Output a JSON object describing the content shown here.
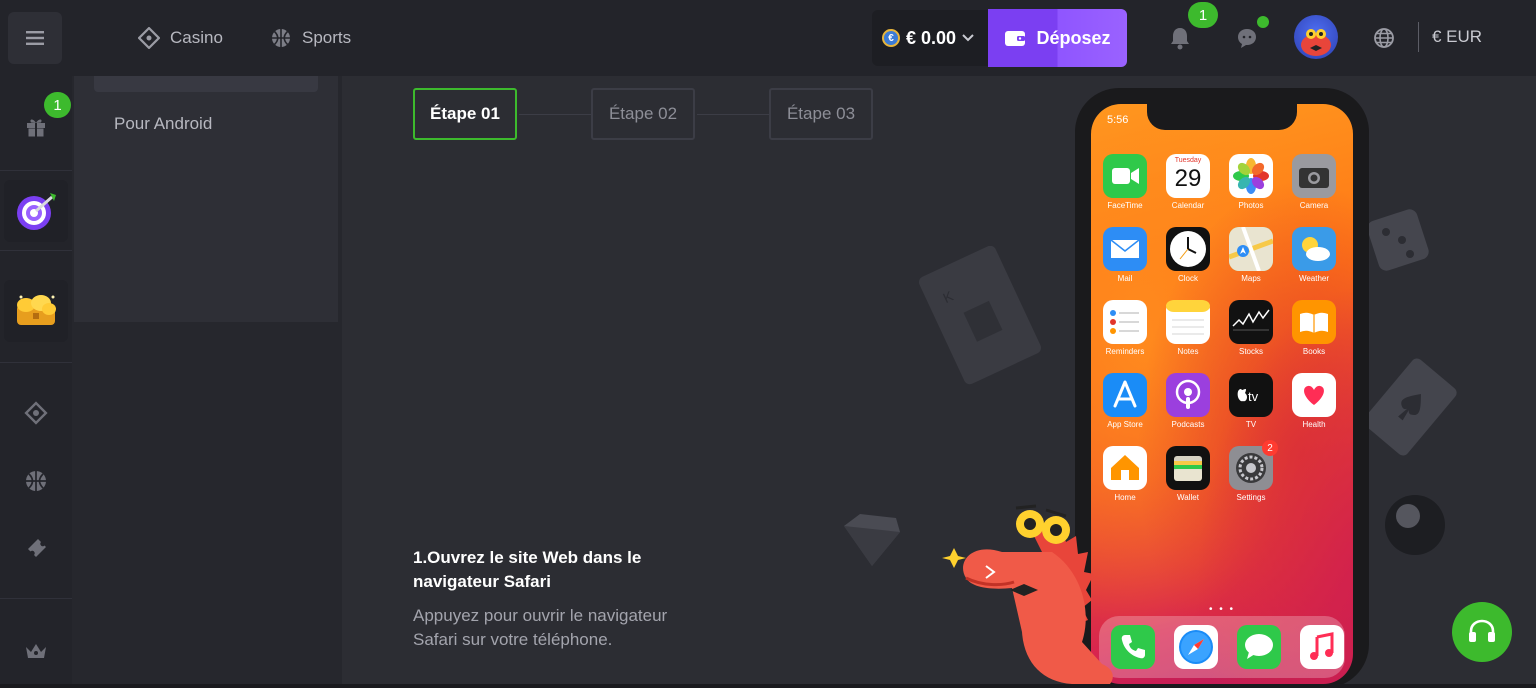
{
  "header": {
    "menu_icon": "hamburger-icon",
    "nav": [
      {
        "label": "Casino",
        "icon": "casino-icon"
      },
      {
        "label": "Sports",
        "icon": "basketball-icon"
      }
    ],
    "balance": "€ 0.00",
    "coin_symbol": "€",
    "deposit_label": "Déposez",
    "notifications_count": "1",
    "currency": "€ EUR"
  },
  "rail": {
    "gift_badge": "1",
    "items": [
      "gift-icon",
      "target-game-icon",
      "treasure-icon",
      "casino-icon",
      "basketball-icon",
      "ticket-icon",
      "crown-icon"
    ]
  },
  "subpanel": {
    "android_link": "Pour Android"
  },
  "steps": [
    "Étape 01",
    "Étape 02",
    "Étape 03"
  ],
  "instruction": {
    "title": "1.Ouvrez le site Web dans le navigateur Safari",
    "text": "Appuyez pour ouvrir le navigateur Safari sur votre téléphone."
  },
  "phone": {
    "time": "5:56",
    "calendar_day": "Tuesday",
    "calendar_date": "29",
    "settings_badge": "2",
    "apps": [
      {
        "label": "FaceTime",
        "color": "#2fc94a"
      },
      {
        "label": "Calendar",
        "color": "#ffffff"
      },
      {
        "label": "Photos",
        "color": "#ffffff"
      },
      {
        "label": "Camera",
        "color": "#9a9a9f"
      },
      {
        "label": "Mail",
        "color": "#2d8df5"
      },
      {
        "label": "Clock",
        "color": "#111111"
      },
      {
        "label": "Maps",
        "color": "#7dd36f"
      },
      {
        "label": "Weather",
        "color": "#3a9be8"
      },
      {
        "label": "Reminders",
        "color": "#ffffff"
      },
      {
        "label": "Notes",
        "color": "#ffd43b"
      },
      {
        "label": "Stocks",
        "color": "#111111"
      },
      {
        "label": "Books",
        "color": "#ff9500"
      },
      {
        "label": "App Store",
        "color": "#1a8cf7"
      },
      {
        "label": "Podcasts",
        "color": "#9b3fde"
      },
      {
        "label": "TV",
        "color": "#111111"
      },
      {
        "label": "Health",
        "color": "#ffffff"
      },
      {
        "label": "Home",
        "color": "#ffffff"
      },
      {
        "label": "Wallet",
        "color": "#111111"
      },
      {
        "label": "Settings",
        "color": "#8e8e93"
      }
    ],
    "dock": [
      {
        "name": "phone-app-icon",
        "color": "#2fc94a"
      },
      {
        "name": "safari-app-icon",
        "color": "#ffffff"
      },
      {
        "name": "messages-app-icon",
        "color": "#2fc94a"
      },
      {
        "name": "music-app-icon",
        "color": "#ffffff"
      }
    ]
  },
  "colors": {
    "accent_green": "#3dba2d",
    "deposit_purple": "#7b3ff2",
    "background": "#2c2d33"
  }
}
